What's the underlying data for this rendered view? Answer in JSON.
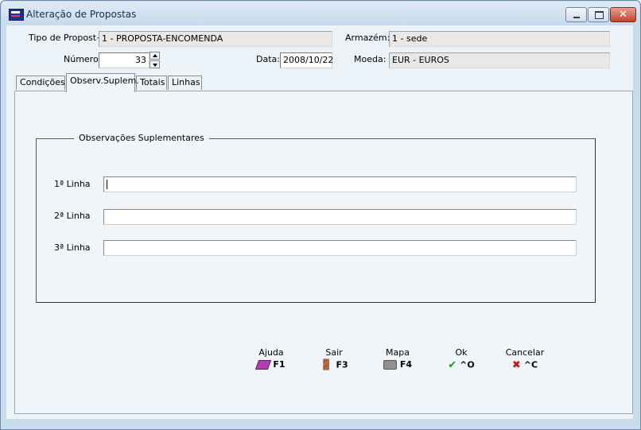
{
  "window": {
    "title": "Alteração de Propostas",
    "icons": {
      "app": "app-icon",
      "minimize": "minimize-icon",
      "maximize": "maximize-icon",
      "close": "close-icon"
    },
    "close_glyph": "✕"
  },
  "header": {
    "tipo_label": "Tipo de Propost~:",
    "tipo_value": "1 - PROPOSTA-ENCOMENDA",
    "armazem_label": "Armazém:",
    "armazem_value": "1 - sede",
    "numero_label": "Número:",
    "numero_value": "33",
    "data_label": "Data:",
    "data_value": "2008/10/22",
    "moeda_label": "Moeda:",
    "moeda_value": "EUR - EUROS"
  },
  "tabs": [
    {
      "label": "Condições"
    },
    {
      "label": "Observ.Suplem.",
      "active": true
    },
    {
      "label": "Totais"
    },
    {
      "label": "Linhas"
    }
  ],
  "group": {
    "title": "Observações Suplementares",
    "lines": [
      {
        "label": "1ª Linha",
        "value": ""
      },
      {
        "label": "2ª Linha",
        "value": ""
      },
      {
        "label": "3ª Linha",
        "value": ""
      }
    ]
  },
  "toolbar": [
    {
      "label": "Ajuda",
      "key": "F1",
      "icon": "help-book-icon"
    },
    {
      "label": "Sair",
      "key": "F3",
      "icon": "exit-door-icon"
    },
    {
      "label": "Mapa",
      "key": "F4",
      "icon": "printer-icon"
    },
    {
      "label": "Ok",
      "key": "^O",
      "icon": "checkmark-icon"
    },
    {
      "label": "Cancelar",
      "key": "^C",
      "icon": "cancel-x-icon"
    }
  ],
  "colors": {
    "accent": "#1c9a1c",
    "cancel": "#c01818",
    "window_frame": "#c8dceb"
  }
}
